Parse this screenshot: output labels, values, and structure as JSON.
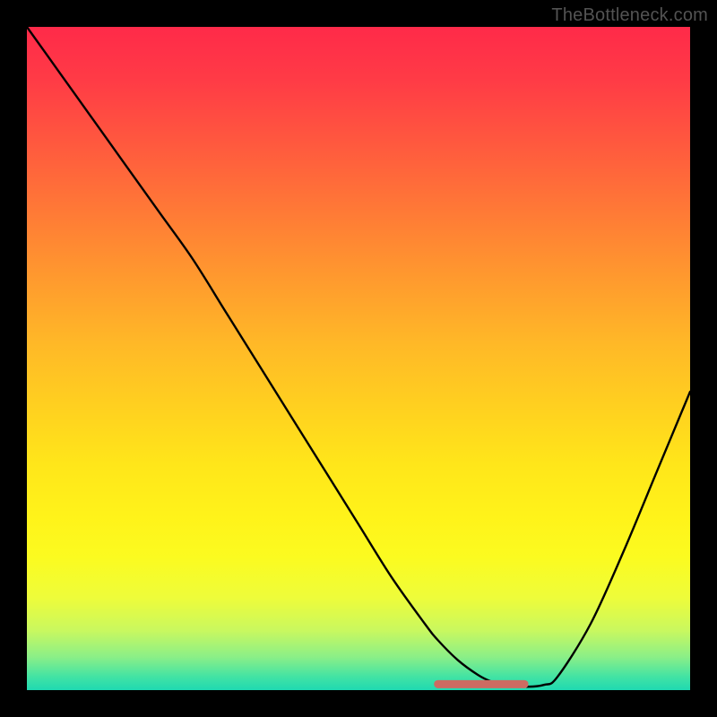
{
  "watermark": "TheBottleneck.com",
  "colors": {
    "background": "#000000",
    "curve": "#000000",
    "highlight": "#cc6b62",
    "gradient_top": "#ff2a49",
    "gradient_bottom": "#1fd9b1"
  },
  "chart_data": {
    "type": "line",
    "title": "",
    "xlabel": "",
    "ylabel": "",
    "xlim": [
      0,
      100
    ],
    "ylim": [
      0,
      100
    ],
    "grid": false,
    "legend": null,
    "series": [
      {
        "name": "bottleneck-curve",
        "x": [
          0,
          5,
          10,
          15,
          20,
          25,
          30,
          35,
          40,
          45,
          50,
          55,
          60,
          62,
          65,
          68,
          70,
          72,
          75,
          78,
          80,
          85,
          90,
          95,
          100
        ],
        "values": [
          100,
          93,
          86,
          79,
          72,
          65,
          57,
          49,
          41,
          33,
          25,
          17,
          10,
          7.5,
          4.5,
          2.3,
          1.3,
          0.8,
          0.5,
          0.8,
          2.0,
          10,
          21,
          33,
          45
        ]
      }
    ],
    "annotations": [
      {
        "name": "optimal-range",
        "x_start": 62,
        "x_end": 75,
        "y": 0.9
      }
    ]
  }
}
